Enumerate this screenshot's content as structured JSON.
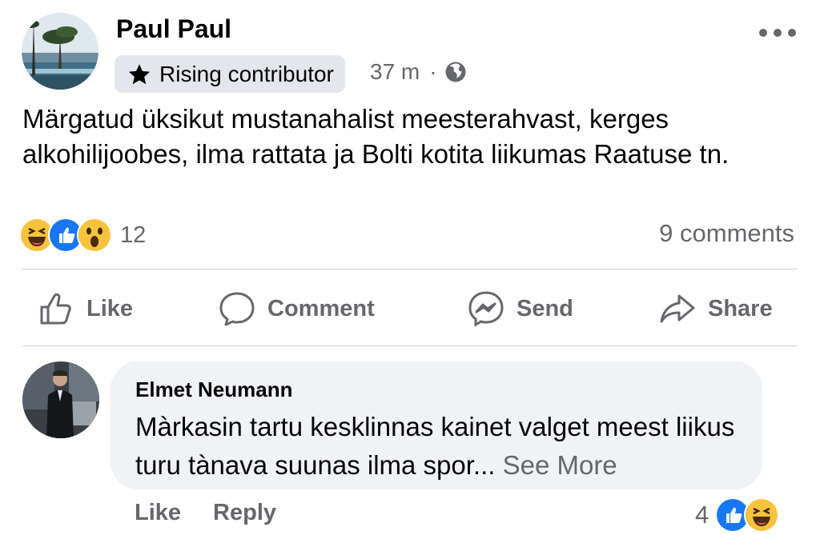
{
  "post": {
    "author": "Paul Paul",
    "badge": "Rising contributor",
    "time": "37 m",
    "separator": "·",
    "text": "Märgatud üksikut mustanahalist meesterahvast, kerges alkohilijoobes, ilma rattata ja Bolti kotita liikumas Raatuse tn.",
    "reactions": [
      "haha",
      "like",
      "wow"
    ],
    "reaction_count": "12",
    "comments_count": "9 comments"
  },
  "actions": {
    "like": "Like",
    "comment": "Comment",
    "send": "Send",
    "share": "Share"
  },
  "comment": {
    "author": "Elmet Neumann",
    "text": "Màrkasin tartu kesklinnas kainet valget meest liikus turu tànava suunas ilma spor...",
    "see_more": "See More",
    "like": "Like",
    "reply": "Reply",
    "reaction_count": "4",
    "reactions": [
      "like",
      "haha"
    ]
  },
  "colors": {
    "like_blue": "#1877f2",
    "emoji_yellow": "#f7c33c",
    "secondary_text": "#65676b",
    "bubble": "#f0f2f5"
  },
  "icons": [
    "more-icon",
    "star-icon",
    "globe-icon",
    "like-icon",
    "comment-icon",
    "messenger-icon",
    "share-icon"
  ]
}
